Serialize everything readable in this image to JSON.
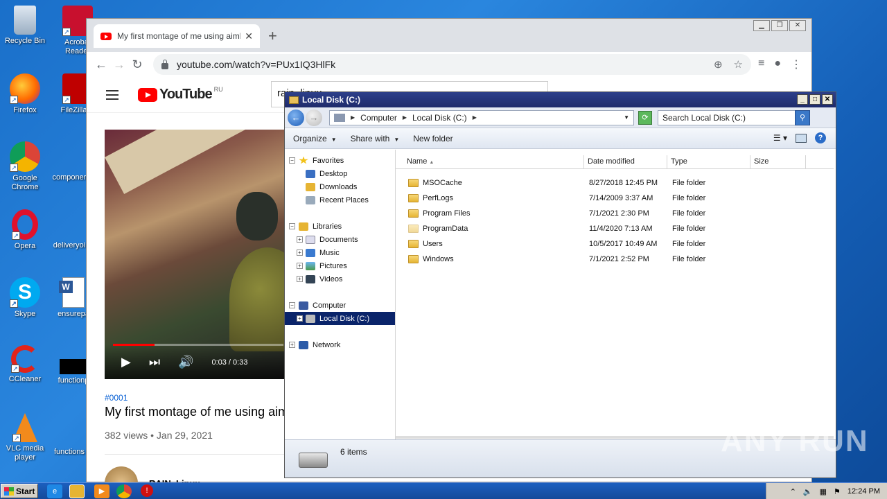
{
  "desktop": {
    "icons": [
      {
        "label": "Recycle Bin"
      },
      {
        "label": "Acrobat Reader"
      },
      {
        "label": "Firefox"
      },
      {
        "label": "FileZilla C"
      },
      {
        "label": "Google Chrome"
      },
      {
        "label": "componer"
      },
      {
        "label": "Opera"
      },
      {
        "label": "deliveryoi"
      },
      {
        "label": "Skype"
      },
      {
        "label": "ensurepa"
      },
      {
        "label": "CCleaner"
      },
      {
        "label": "functionp"
      },
      {
        "label": "VLC media player"
      },
      {
        "label": "functions"
      }
    ]
  },
  "chrome": {
    "tab_title": "My first montage of me using aimbot",
    "url": "youtube.com/watch?v=PUx1IQ3HlFk"
  },
  "youtube": {
    "logo_text": "YouTube",
    "region": "RU",
    "search_value": "rain_linux",
    "video_time": "0:03 / 0:33",
    "hashtag": "#0001",
    "video_title": "My first montage of me using aimbot",
    "meta": "382 views • Jan 29, 2021",
    "channel": "RAIN_Linux"
  },
  "explorer": {
    "title": "Local Disk (C:)",
    "breadcrumb": [
      "Computer",
      "Local Disk (C:)"
    ],
    "search_placeholder": "Search Local Disk (C:)",
    "commands": {
      "organize": "Organize",
      "share": "Share with",
      "new_folder": "New folder"
    },
    "nav": {
      "favorites": "Favorites",
      "desktop": "Desktop",
      "downloads": "Downloads",
      "recent": "Recent Places",
      "libraries": "Libraries",
      "documents": "Documents",
      "music": "Music",
      "pictures": "Pictures",
      "videos": "Videos",
      "computer": "Computer",
      "local_disk": "Local Disk (C:)",
      "network": "Network"
    },
    "columns": {
      "name": "Name",
      "date": "Date modified",
      "type": "Type",
      "size": "Size"
    },
    "files": [
      {
        "name": "MSOCache",
        "date": "8/27/2018 12:45 PM",
        "type": "File folder"
      },
      {
        "name": "PerfLogs",
        "date": "7/14/2009 3:37 AM",
        "type": "File folder"
      },
      {
        "name": "Program Files",
        "date": "7/1/2021 2:30 PM",
        "type": "File folder"
      },
      {
        "name": "ProgramData",
        "date": "11/4/2020 7:13 AM",
        "type": "File folder"
      },
      {
        "name": "Users",
        "date": "10/5/2017 10:49 AM",
        "type": "File folder"
      },
      {
        "name": "Windows",
        "date": "7/1/2021 2:52 PM",
        "type": "File folder"
      }
    ],
    "status": "6 items"
  },
  "taskbar": {
    "start": "Start",
    "clock": "12:24 PM"
  },
  "watermark": "ANY RUN"
}
